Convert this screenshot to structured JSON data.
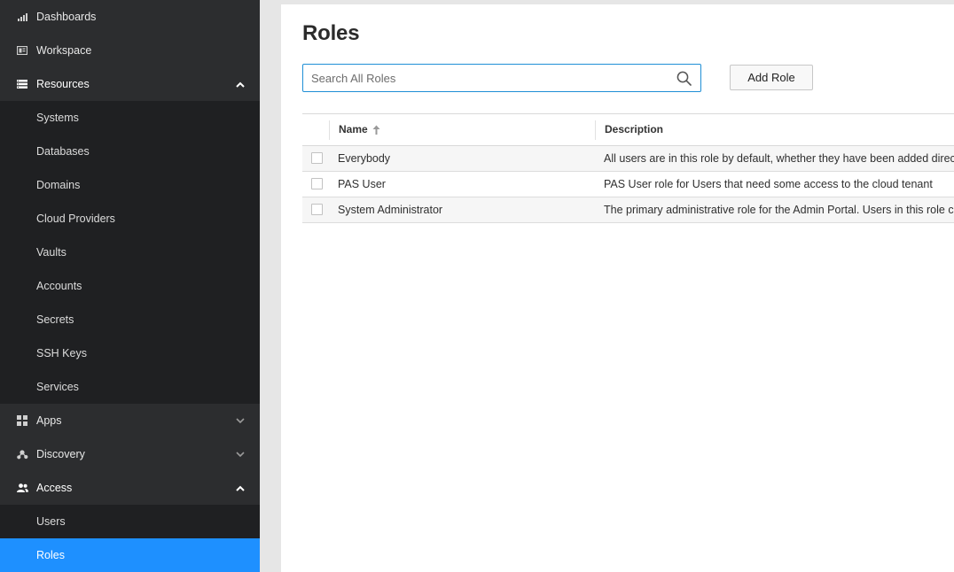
{
  "sidebar": {
    "items": [
      {
        "label": "Dashboards",
        "icon": "bar-chart-icon"
      },
      {
        "label": "Workspace",
        "icon": "workspace-icon"
      },
      {
        "label": "Resources",
        "icon": "server-list-icon",
        "expanded": true,
        "children": [
          "Systems",
          "Databases",
          "Domains",
          "Cloud Providers",
          "Vaults",
          "Accounts",
          "Secrets",
          "SSH Keys",
          "Services"
        ]
      },
      {
        "label": "Apps",
        "icon": "apps-grid-icon",
        "expanded": false
      },
      {
        "label": "Discovery",
        "icon": "discovery-icon",
        "expanded": false
      },
      {
        "label": "Access",
        "icon": "users-icon",
        "expanded": true,
        "children": [
          "Users",
          "Roles"
        ],
        "active_child": "Roles"
      }
    ]
  },
  "main": {
    "title": "Roles",
    "search": {
      "placeholder": "Search All Roles",
      "value": ""
    },
    "add_button": "Add Role",
    "table": {
      "columns": [
        "Name",
        "Description"
      ],
      "sort": {
        "column": "Name",
        "direction": "ascending"
      },
      "rows": [
        {
          "name": "Everybody",
          "description": "All users are in this role by default, whether they have been added directly to"
        },
        {
          "name": "PAS User",
          "description": "PAS User role for Users that need some access to the cloud tenant"
        },
        {
          "name": "System Administrator",
          "description": "The primary administrative role for the Admin Portal. Users in this role can"
        }
      ]
    }
  },
  "colors": {
    "sidebar_bg": "#2c2d2f",
    "submenu_bg": "#1f2022",
    "active": "#1e90ff",
    "search_border": "#1f8fd6"
  }
}
